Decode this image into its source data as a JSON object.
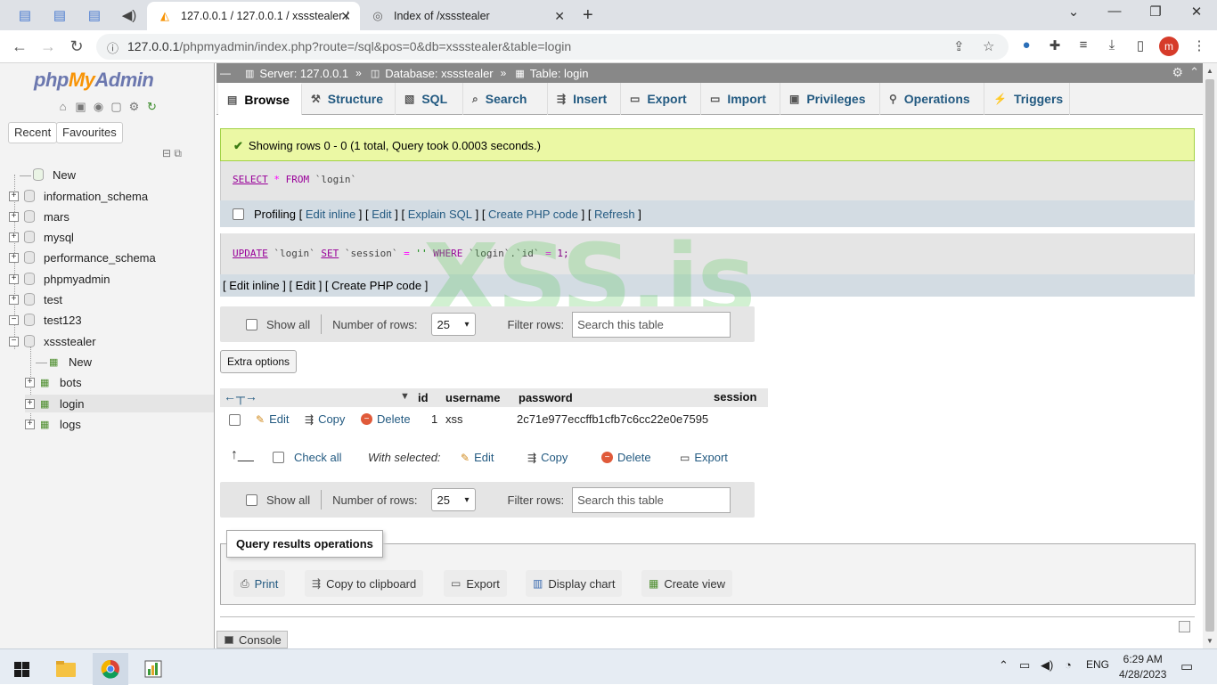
{
  "browser": {
    "tabs": [
      {
        "title": "127.0.0.1 / 127.0.0.1 / xssstealer / ",
        "active": true
      },
      {
        "title": "Index of /xssstealer",
        "active": false
      }
    ],
    "url_host": "127.0.0.1",
    "url_path": "/phpmyadmin/index.php?route=/sql&pos=0&db=xssstealer&table=login",
    "avatar_letter": "m"
  },
  "pma": {
    "logo": {
      "php": "php",
      "my": "My",
      "admin": "Admin"
    },
    "left_buttons": [
      "Recent",
      "Favourites"
    ],
    "tree": {
      "new": "New",
      "databases": [
        "information_schema",
        "mars",
        "mysql",
        "performance_schema",
        "phpmyadmin",
        "test",
        "test123",
        "xssstealer"
      ],
      "xss_children": {
        "new": "New",
        "tables": [
          "bots",
          "login",
          "logs"
        ]
      }
    },
    "breadcrumb": {
      "server": "Server: 127.0.0.1",
      "database": "Database: xssstealer",
      "table": "Table: login"
    },
    "tabs": [
      "Browse",
      "Structure",
      "SQL",
      "Search",
      "Insert",
      "Export",
      "Import",
      "Privileges",
      "Operations",
      "Triggers"
    ],
    "success_message": "Showing rows 0 - 0 (1 total, Query took 0.0003 seconds.)",
    "query1": {
      "kw1": "SELECT",
      "star": "*",
      "kw2": "FROM",
      "table": "`login`"
    },
    "query_links": {
      "profiling": "Profiling",
      "edit_inline": "Edit inline",
      "edit": "Edit",
      "explain": "Explain SQL",
      "create_php": "Create PHP code",
      "refresh": "Refresh"
    },
    "query2": {
      "kw1": "UPDATE",
      "table": "`login`",
      "kw2": "SET",
      "col": "`session`",
      "eq": "=",
      "val": "''",
      "kw3": "WHERE",
      "cond": "`login`.`id`",
      "eq2": "=",
      "num": "1;"
    },
    "query2_links": {
      "edit_inline": "Edit inline",
      "edit": "Edit",
      "create_php": "Create PHP code"
    },
    "nav": {
      "show_all": "Show all",
      "number_of_rows": "Number of rows:",
      "rows_value": "25",
      "filter_rows": "Filter rows:",
      "search_placeholder": "Search this table"
    },
    "extra_options": "Extra options",
    "columns": [
      "id",
      "username",
      "password",
      "session"
    ],
    "rows": [
      {
        "id": "1",
        "username": "xss",
        "password": "2c71e977eccffb1cfb7c6cc22e0e7595",
        "session": ""
      }
    ],
    "row_actions": {
      "edit": "Edit",
      "copy": "Copy",
      "delete": "Delete"
    },
    "with_selected": {
      "check_all": "Check all",
      "label": "With selected:",
      "edit": "Edit",
      "copy": "Copy",
      "delete": "Delete",
      "export": "Export"
    },
    "query_ops": {
      "legend": "Query results operations",
      "print": "Print",
      "copy_clipboard": "Copy to clipboard",
      "export": "Export",
      "display_chart": "Display chart",
      "create_view": "Create view"
    },
    "console": "Console"
  },
  "watermark": "XSS.is",
  "taskbar": {
    "lang": "ENG",
    "time": "6:29 AM",
    "date": "4/28/2023"
  }
}
